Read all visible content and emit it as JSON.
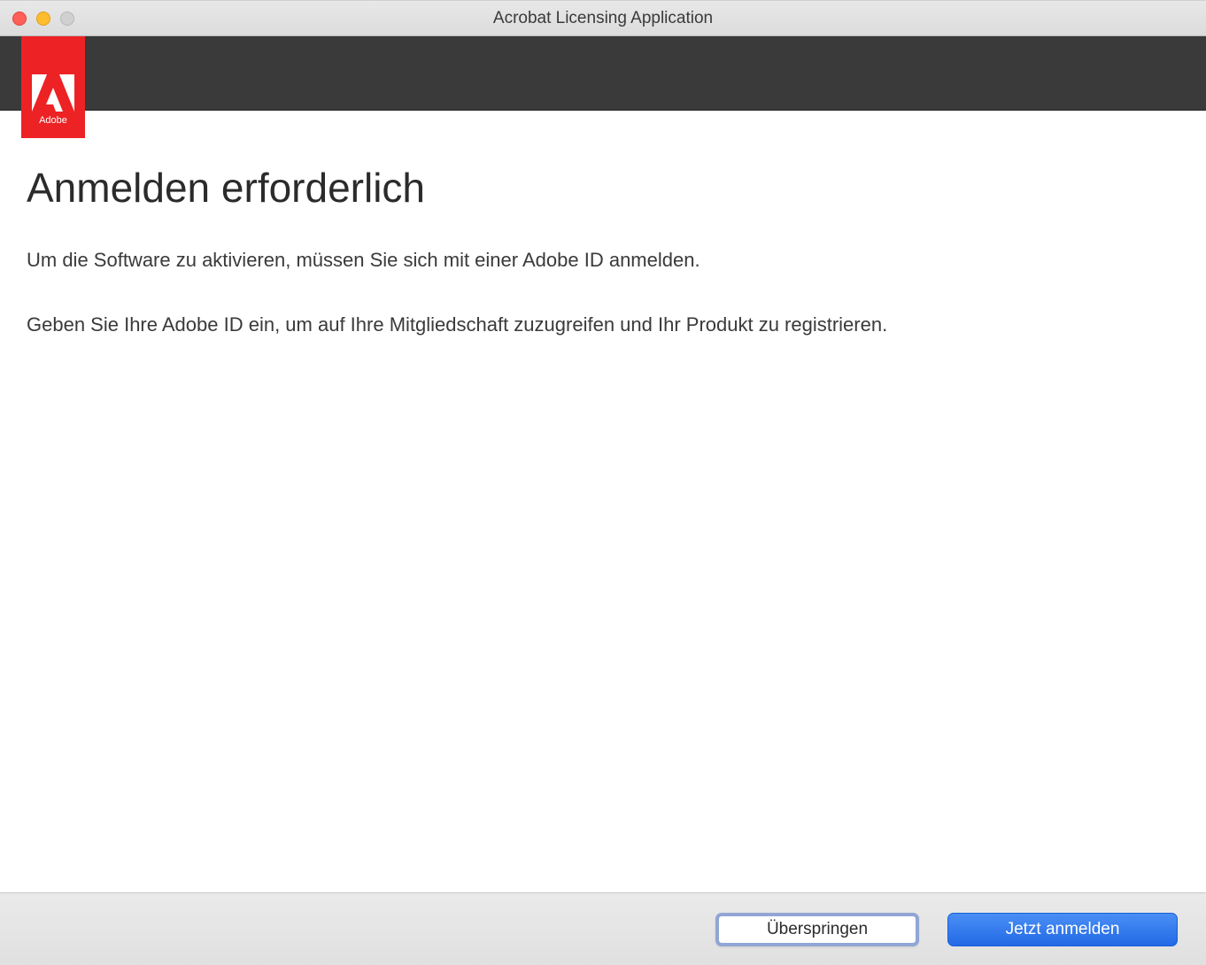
{
  "window": {
    "title": "Acrobat Licensing Application"
  },
  "logo": {
    "brand": "Adobe"
  },
  "content": {
    "heading": "Anmelden erforderlich",
    "paragraph1": "Um die Software zu aktivieren, müssen Sie sich mit einer Adobe ID anmelden.",
    "paragraph2": "Geben Sie Ihre Adobe ID ein, um auf Ihre Mitgliedschaft zuzugreifen und Ihr Produkt zu registrieren."
  },
  "footer": {
    "skip_label": "Überspringen",
    "signin_label": "Jetzt anmelden"
  }
}
